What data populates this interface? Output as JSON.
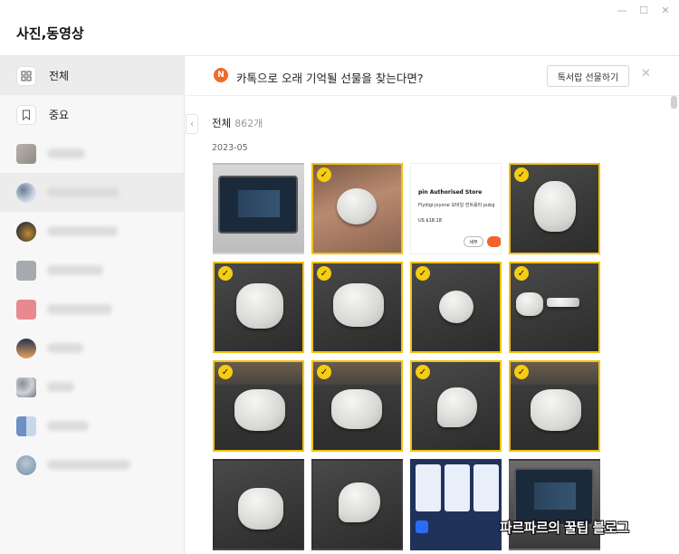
{
  "window": {
    "title": "사진,동영상"
  },
  "sidebar": {
    "items": [
      {
        "label": "전체",
        "icon": "grid-icon",
        "active": true
      },
      {
        "label": "중요",
        "icon": "bookmark-icon",
        "active": false
      }
    ]
  },
  "banner": {
    "badge": "N",
    "text": "카톡으로 오래 기억될 선물을 찾는다면?",
    "button_label": "톡서랍 선물하기"
  },
  "content": {
    "heading": "전체",
    "count": "862개",
    "date_group": "2023-05"
  },
  "store_thumb": {
    "title": "pin Authorised Store",
    "product": "Flydigi-joyone 모바일 컨트롤러 pubg",
    "price": "US $18.18",
    "button": "세부"
  },
  "watermark": "파르파르의 꿀팁 블로그",
  "colors": {
    "selected_border": "#f2c211",
    "badge": "#f06a2a"
  }
}
